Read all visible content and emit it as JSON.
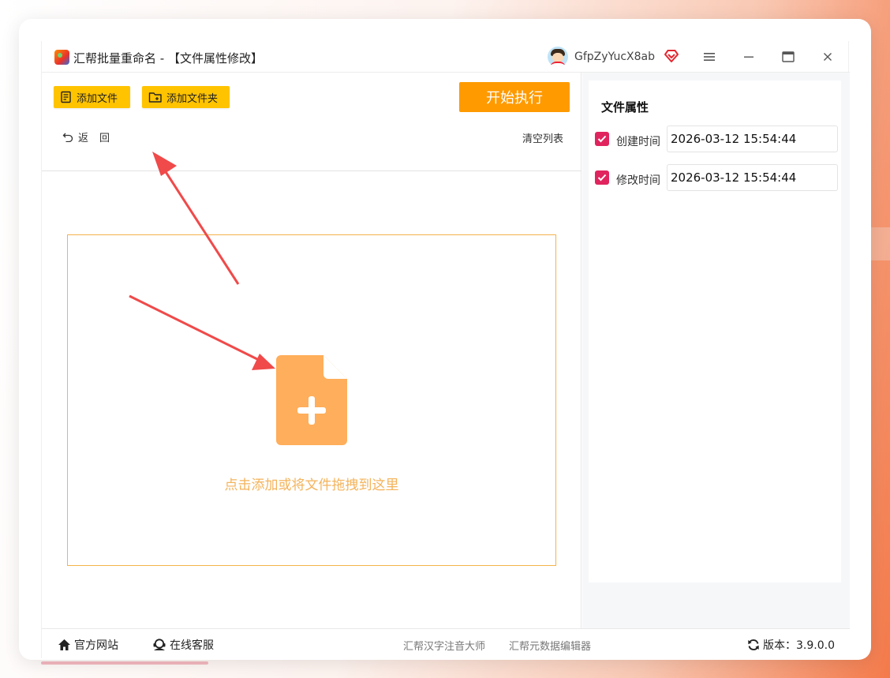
{
  "window": {
    "title": "汇帮批量重命名 - 【文件属性修改】",
    "username": "GfpZyYucX8ab"
  },
  "toolbar": {
    "add_file": "添加文件",
    "add_folder": "添加文件夹",
    "start": "开始执行",
    "back": "返回",
    "clear_list": "清空列表"
  },
  "dropzone": {
    "hint": "点击添加或将文件拖拽到这里",
    "icon": "file-add-icon"
  },
  "properties": {
    "title": "文件属性",
    "created": {
      "label": "创建时间",
      "value": "2026-03-12 15:54:44",
      "checked": true
    },
    "modified": {
      "label": "修改时间",
      "value": "2026-03-12 15:54:44",
      "checked": true
    }
  },
  "footer": {
    "website": "官方网站",
    "service": "在线客服",
    "link1": "汇帮汉字注音大师",
    "link2": "汇帮元数据编辑器",
    "version": "版本：3.9.0.0"
  },
  "colors": {
    "accent_yellow": "#ffc300",
    "start_orange": "#ff9a00",
    "drop_border": "#f4b34a",
    "drop_icon": "#ffae5b",
    "checkbox": "#e0245e",
    "annotation_arrow": "#f04a4a"
  }
}
